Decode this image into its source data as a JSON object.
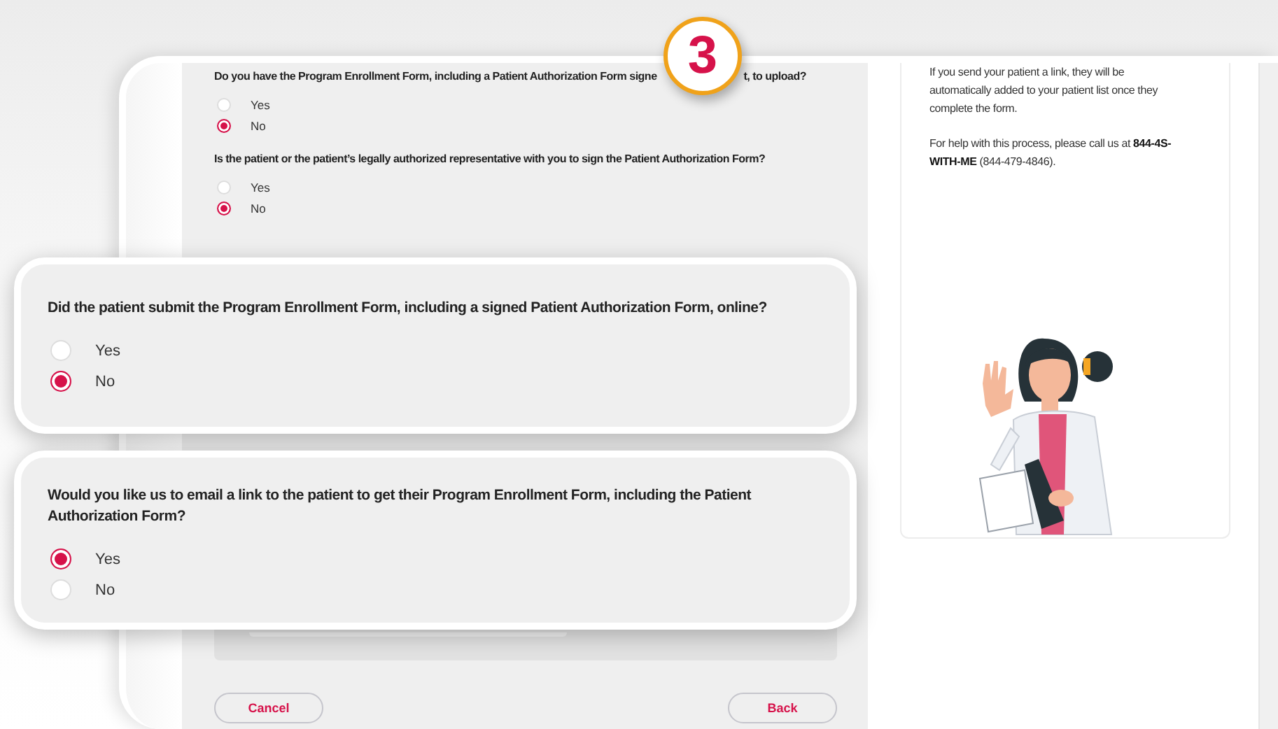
{
  "step_badge": "3",
  "form": {
    "questions": [
      {
        "text_parts": [
          "Do you have the Program Enrollment Form, including a Patient Authorization Form signe",
          "t, to upload?"
        ],
        "options": [
          {
            "label": "Yes",
            "selected": false
          },
          {
            "label": "No",
            "selected": true
          }
        ]
      },
      {
        "text_parts": [
          "Is the patient or the patient’s legally authorized representative with you to sign the Patient Authorization Form?"
        ],
        "options": [
          {
            "label": "Yes",
            "selected": false
          },
          {
            "label": "No",
            "selected": true
          }
        ]
      }
    ],
    "buttons": [
      {
        "label": "Cancel"
      },
      {
        "label": "Back"
      }
    ]
  },
  "sidebar": {
    "paragraphs": [
      "If you send your patient a link, they will be automatically added to your patient list once they complete the form.",
      "For help with this process, please call us at **844-4S-WITH-ME** (844-479-4846)."
    ]
  },
  "callouts": [
    {
      "question": "Did the patient submit the Program Enrollment Form, including a signed Patient Authorization Form, online?",
      "options": [
        {
          "label": "Yes",
          "selected": false
        },
        {
          "label": "No",
          "selected": true
        }
      ]
    },
    {
      "question": "Would you like us to email a link to the patient to get their Program Enrollment Form, including the Patient Authorization Form?",
      "options": [
        {
          "label": "Yes",
          "selected": true
        },
        {
          "label": "No",
          "selected": false
        }
      ]
    }
  ]
}
